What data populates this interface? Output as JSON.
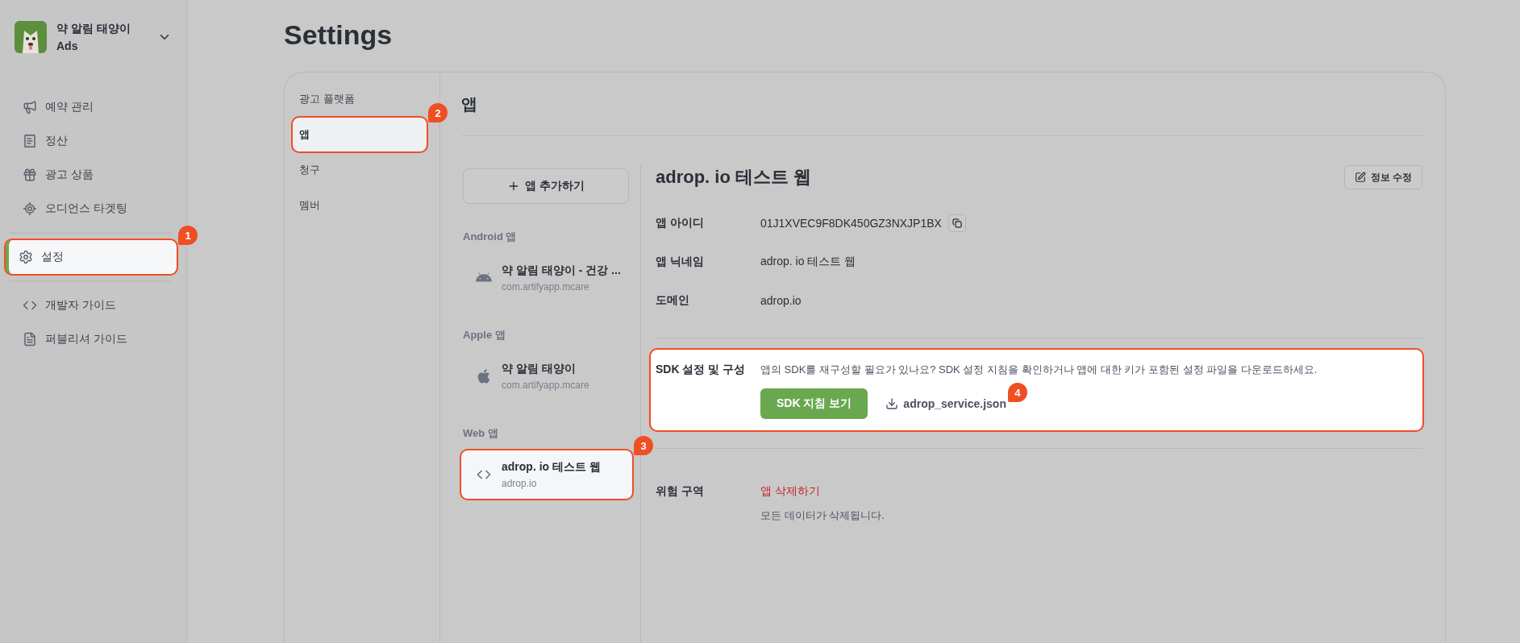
{
  "sidebar": {
    "brand": {
      "name": "약 알림 태양이",
      "subtitle": "Ads"
    },
    "groups": [
      [
        {
          "label": "예약 관리",
          "selected": false
        },
        {
          "label": "정산",
          "selected": false
        },
        {
          "label": "광고 상품",
          "selected": false
        },
        {
          "label": "오디언스 타겟팅",
          "selected": false
        }
      ],
      [
        {
          "label": "설정",
          "selected": true,
          "callout": "1"
        }
      ],
      [
        {
          "label": "개발자 가이드",
          "selected": false
        },
        {
          "label": "퍼블리셔 가이드",
          "selected": false
        }
      ]
    ]
  },
  "page_title": "Settings",
  "settings_nav": [
    {
      "label": "광고 플랫폼",
      "selected": false
    },
    {
      "label": "앱",
      "selected": true,
      "callout": "2"
    },
    {
      "label": "청구",
      "selected": false
    },
    {
      "label": "멤버",
      "selected": false
    }
  ],
  "section_title": "앱",
  "add_app_button": "앱 추가하기",
  "app_groups": [
    {
      "label": "Android 앱",
      "apps": [
        {
          "name": "약 알림 태양이 - 건강 ...",
          "id": "com.artifyapp.mcare",
          "kind": "android",
          "selected": false
        }
      ]
    },
    {
      "label": "Apple 앱",
      "apps": [
        {
          "name": "약 알림 태양이",
          "id": "com.artifyapp.mcare",
          "kind": "apple",
          "selected": false
        }
      ]
    },
    {
      "label": "Web 앱",
      "apps": [
        {
          "name": "adrop. io 테스트 웹",
          "id": "adrop.io",
          "kind": "web",
          "selected": true,
          "callout": "3"
        }
      ]
    }
  ],
  "detail": {
    "title": "adrop. io 테스트 웹",
    "edit_button": "정보 수정",
    "fields": [
      {
        "label": "앱 아이디",
        "value": "01J1XVEC9F8DK450GZ3NXJP1BX",
        "copyable": true
      },
      {
        "label": "앱 닉네임",
        "value": "adrop. io 테스트 웹",
        "copyable": false
      },
      {
        "label": "도메인",
        "value": "adrop.io",
        "copyable": false
      }
    ],
    "sdk": {
      "label": "SDK 설정 및 구성",
      "description": "앱의 SDK를 재구성할 필요가 있나요? SDK 설정 지침을 확인하거나 앱에 대한 키가 포함된 설정 파일을 다운로드하세요.",
      "button": "SDK 지침 보기",
      "download": "adrop_service.json",
      "callout": "4"
    },
    "danger": {
      "label": "위험 구역",
      "action": "앱 삭제하기",
      "note": "모든 데이터가 삭제됩니다."
    }
  }
}
